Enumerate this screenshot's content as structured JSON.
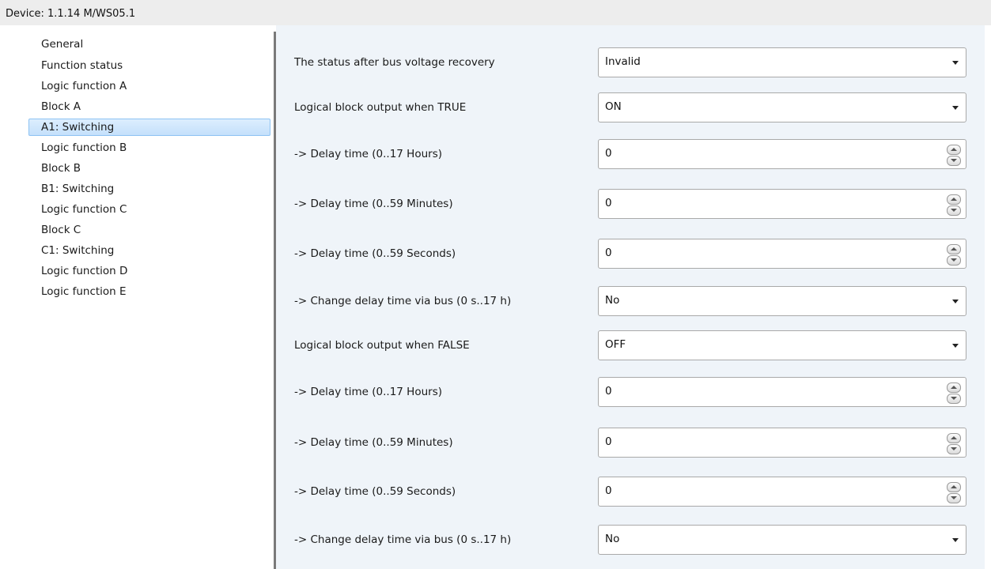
{
  "device": {
    "title": "Device: 1.1.14  M/WS05.1"
  },
  "nav": {
    "items": [
      {
        "label": "General"
      },
      {
        "label": "Function status"
      },
      {
        "label": "Logic function A"
      },
      {
        "label": "Block A"
      },
      {
        "label": "A1: Switching",
        "selected": true
      },
      {
        "label": "Logic function B"
      },
      {
        "label": "Block B"
      },
      {
        "label": "B1: Switching"
      },
      {
        "label": "Logic function C"
      },
      {
        "label": "Block C"
      },
      {
        "label": "C1: Switching"
      },
      {
        "label": "Logic function D"
      },
      {
        "label": "Logic function E"
      }
    ]
  },
  "params": [
    {
      "label": "The status after bus voltage recovery",
      "type": "select",
      "value": "Invalid"
    },
    {
      "label": "Logical block output when TRUE",
      "type": "select",
      "value": "ON"
    },
    {
      "label": "-> Delay time (0..17 Hours)",
      "type": "spin",
      "value": "0"
    },
    {
      "label": "-> Delay time (0..59 Minutes)",
      "type": "spin",
      "value": "0"
    },
    {
      "label": "-> Delay time (0..59 Seconds)",
      "type": "spin",
      "value": "0"
    },
    {
      "label": "-> Change delay time via bus (0 s..17 h)",
      "type": "select",
      "value": "No"
    },
    {
      "label": "Logical block output when FALSE",
      "type": "select",
      "value": "OFF"
    },
    {
      "label": "-> Delay time (0..17 Hours)",
      "type": "spin",
      "value": "0"
    },
    {
      "label": "-> Delay time (0..59 Minutes)",
      "type": "spin",
      "value": "0"
    },
    {
      "label": "-> Delay time (0..59 Seconds)",
      "type": "spin",
      "value": "0"
    },
    {
      "label": "-> Change delay time via bus (0 s..17 h)",
      "type": "select",
      "value": "No"
    }
  ],
  "colors": {
    "selected_bg": "#cfe6fc",
    "panel_bg": "#eff4f9",
    "splitter": "#7a7a7a"
  },
  "icons": {
    "dropdown": "chevron-down-icon",
    "spin_up": "arrow-up-icon",
    "spin_down": "arrow-down-icon"
  }
}
